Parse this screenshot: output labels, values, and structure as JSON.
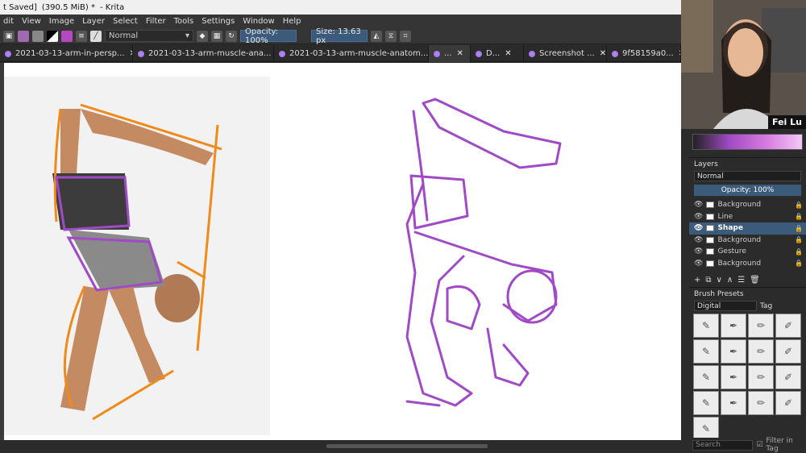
{
  "window": {
    "title_status": "t Saved]",
    "memory": "(390.5 MiB) *",
    "app": "- Krita"
  },
  "menu": [
    "dit",
    "View",
    "Image",
    "Layer",
    "Select",
    "Filter",
    "Tools",
    "Settings",
    "Window",
    "Help"
  ],
  "toolbar": {
    "blend_mode": "Normal",
    "opacity": "Opacity: 100%",
    "size": "Size: 13.63 px"
  },
  "tabs": [
    {
      "label": "2021-03-13-arm-in-persp...",
      "close": "✕"
    },
    {
      "label": "2021-03-13-arm-muscle-ana...",
      "close": "✕"
    },
    {
      "label": "2021-03-13-arm-muscle-anatom...",
      "close": "✕"
    },
    {
      "label": "...",
      "close": "✕"
    },
    {
      "label": "D...",
      "close": "✕"
    },
    {
      "label": "Screenshot ...",
      "close": "✕"
    },
    {
      "label": "9f58159a0...",
      "close": "✕"
    }
  ],
  "webcam": {
    "name": "Fei Lu"
  },
  "layers_panel": {
    "title": "Layers",
    "blend_mode": "Normal",
    "opacity": "Opacity: 100%",
    "layers": [
      {
        "name": "Background",
        "selected": false
      },
      {
        "name": "Line",
        "selected": false
      },
      {
        "name": "Shape",
        "selected": true
      },
      {
        "name": "Background",
        "selected": false
      },
      {
        "name": "Gesture",
        "selected": false
      },
      {
        "name": "Background",
        "selected": false
      }
    ]
  },
  "brush_presets": {
    "title": "Brush Presets",
    "category": "Digital",
    "tag": "Tag",
    "search_placeholder": "Search",
    "filter_label": "Filter in Tag"
  },
  "colors": {
    "accent": "#3c5a7a",
    "sketch_purple": "#a04ac6",
    "sketch_orange": "#f08a1a"
  }
}
